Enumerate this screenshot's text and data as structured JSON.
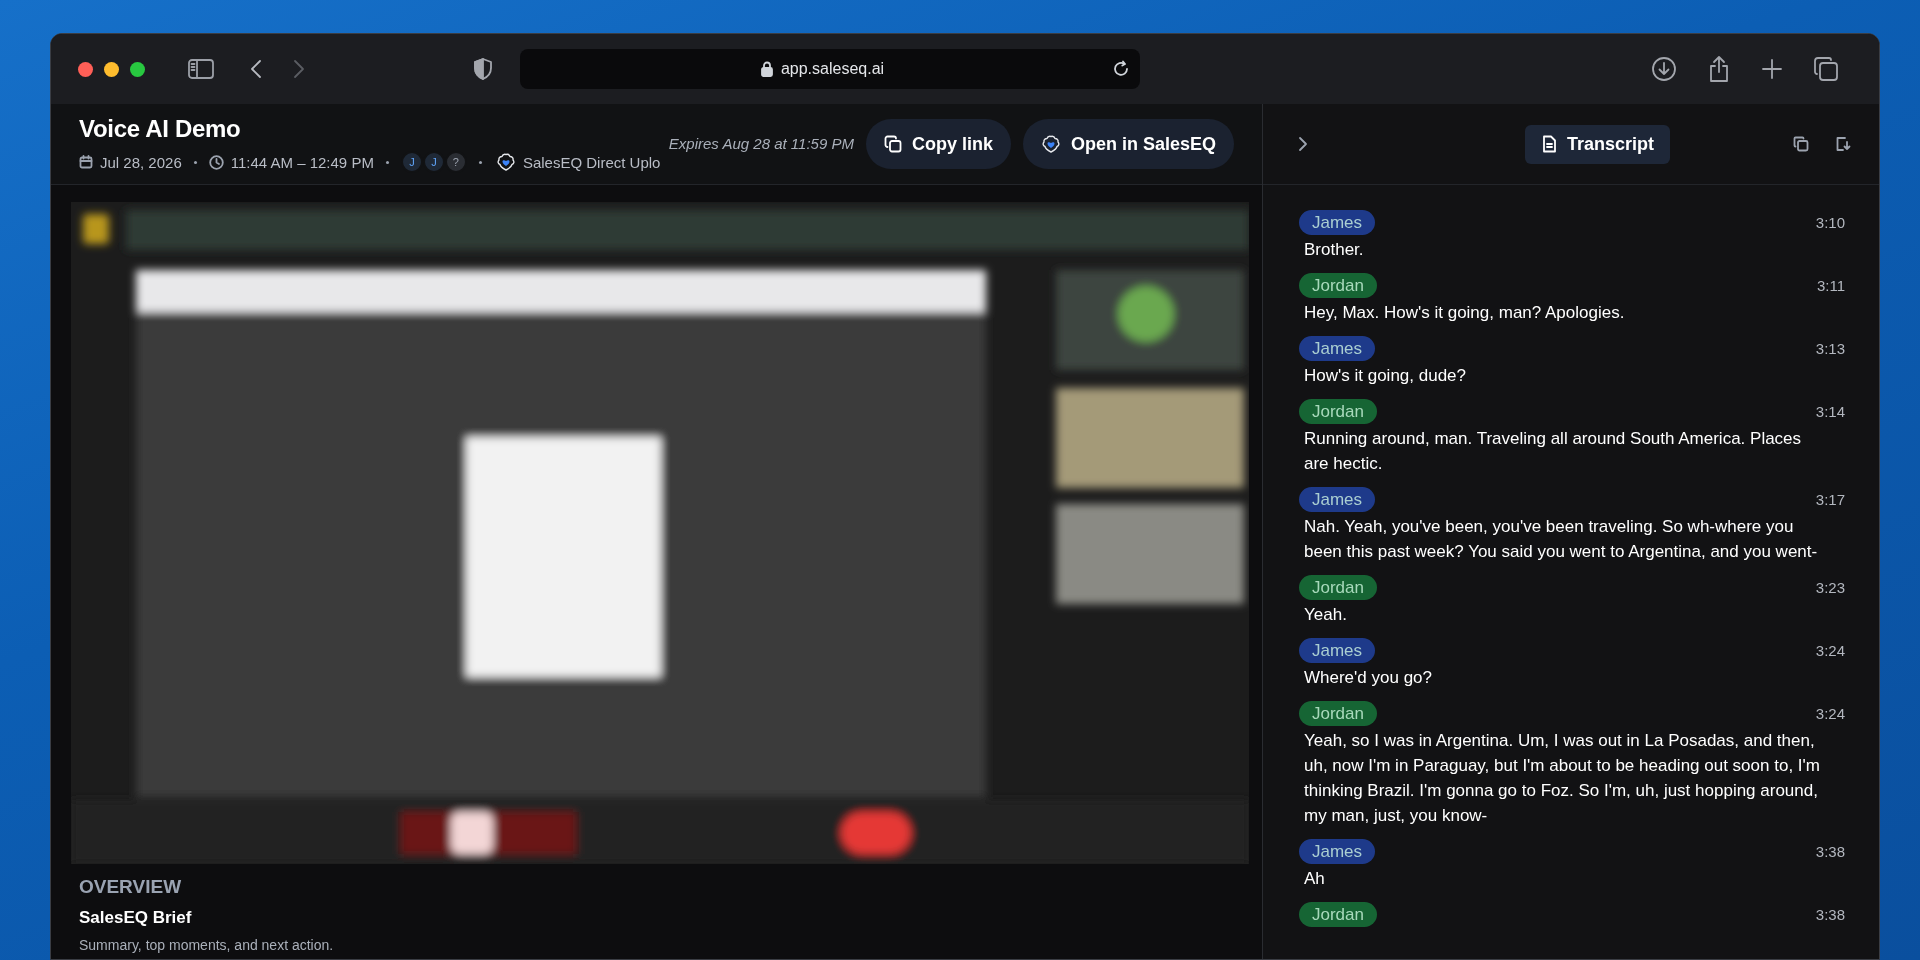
{
  "browser": {
    "url": "app.saleseq.ai"
  },
  "meeting": {
    "title": "Voice AI Demo",
    "date": "Jul 28, 2026",
    "time": "11:44 AM – 12:49 PM",
    "participants": [
      {
        "initial": "J",
        "kind": "known"
      },
      {
        "initial": "J",
        "kind": "known"
      },
      {
        "initial": "?",
        "kind": "unknown"
      }
    ],
    "source": "SalesEQ Direct Uplo",
    "expires": "Expires Aug 28 at 11:59 PM",
    "buttons": [
      {
        "label": "Copy link",
        "kind": "copy"
      },
      {
        "label": "Open in SalesEQ",
        "kind": "brand"
      }
    ]
  },
  "overview": {
    "heading": "OVERVIEW",
    "title": "SalesEQ Brief",
    "subtitle": "Summary, top moments, and next action."
  },
  "transcript": {
    "tabs": [
      {
        "label": "Transcript",
        "selected": true
      }
    ],
    "entries": [
      {
        "speaker": "James",
        "color": "#1e3a8a",
        "time": "3:10",
        "text": "Brother."
      },
      {
        "speaker": "Jordan",
        "color": "#166534",
        "time": "3:11",
        "text": "Hey, Max. How's it going, man? Apologies."
      },
      {
        "speaker": "James",
        "color": "#1e3a8a",
        "time": "3:13",
        "text": "How's it going, dude?"
      },
      {
        "speaker": "Jordan",
        "color": "#166534",
        "time": "3:14",
        "text": "Running around, man. Traveling all around South America. Places are hectic."
      },
      {
        "speaker": "James",
        "color": "#1e3a8a",
        "time": "3:17",
        "text": "Nah. Yeah, you've been, you've been traveling. So wh-where you been this past week? You said you went to Argentina, and you went-"
      },
      {
        "speaker": "Jordan",
        "color": "#166534",
        "time": "3:23",
        "text": "Yeah."
      },
      {
        "speaker": "James",
        "color": "#1e3a8a",
        "time": "3:24",
        "text": "Where'd you go?"
      },
      {
        "speaker": "Jordan",
        "color": "#166534",
        "time": "3:24",
        "text": "Yeah, so I was in Argentina. Um, I was out in La Posadas, and then, uh, now I'm in Paraguay, but I'm about to be heading out soon to, I'm thinking Brazil. I'm gonna go to Foz. So I'm, uh, just hopping around, my man, just, you know-"
      },
      {
        "speaker": "James",
        "color": "#1e3a8a",
        "time": "3:38",
        "text": "Ah"
      },
      {
        "speaker": "Jordan",
        "color": "#166534",
        "time": "3:38"
      }
    ]
  }
}
